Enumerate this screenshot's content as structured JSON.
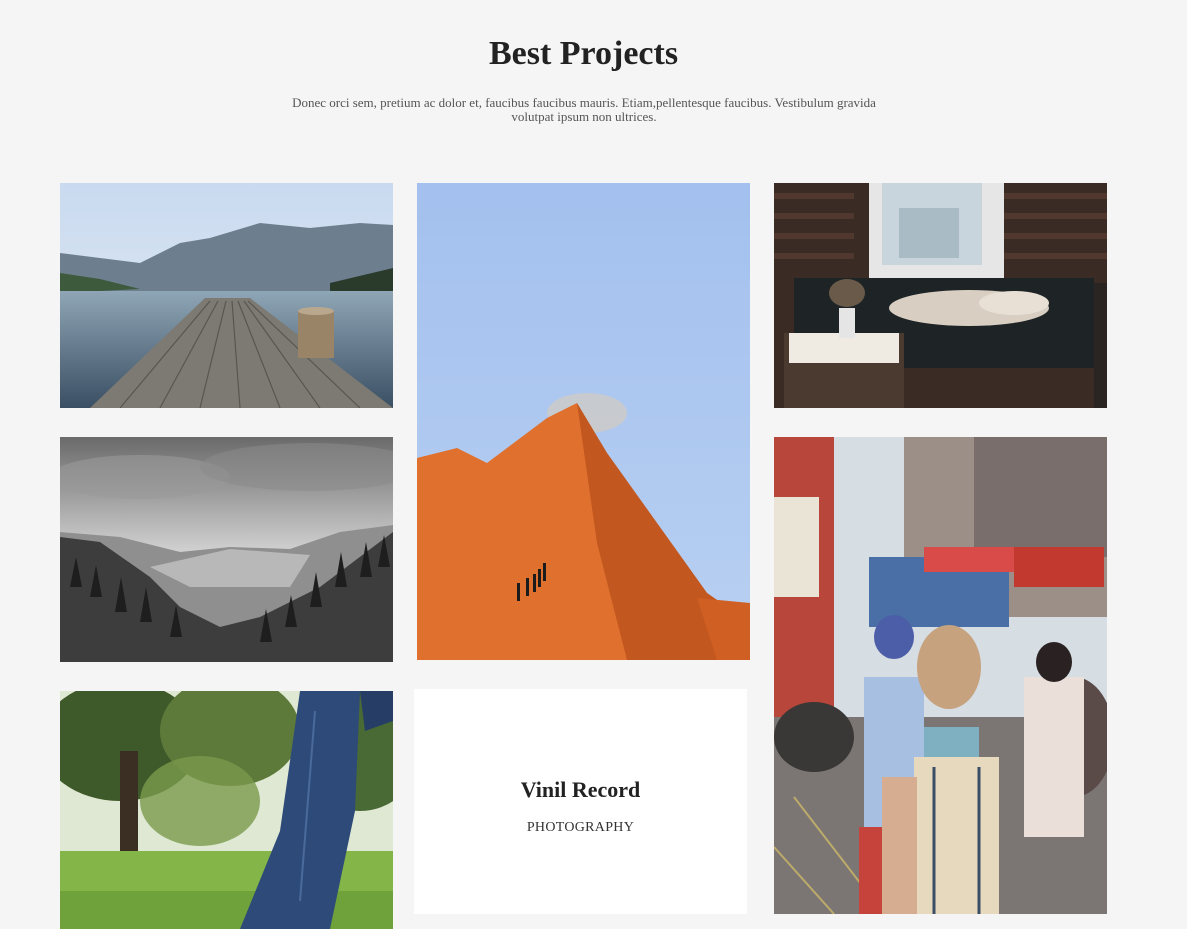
{
  "section": {
    "title": "Best Projects",
    "description": "Donec orci sem, pretium ac dolor et, faucibus faucibus mauris. Etiam,pellentesque faucibus. Vestibulum gravida volutpat ipsum non ultrices."
  },
  "projects": [
    {
      "id": "lake",
      "image": "wooden-pier-over-mountain-lake"
    },
    {
      "id": "forest",
      "image": "black-and-white-forest-hills"
    },
    {
      "id": "grass",
      "image": "person-walking-in-park"
    },
    {
      "id": "dune",
      "image": "people-climbing-orange-sand-dune"
    },
    {
      "id": "room",
      "image": "person-sleeping-on-sofa"
    },
    {
      "id": "street",
      "image": "busy-city-street-market"
    }
  ],
  "featured_card": {
    "title": "Vinil Record",
    "category": "PHOTOGRAPHY"
  },
  "colors": {
    "page_background": "#f5f5f5",
    "card_background": "#ffffff",
    "heading": "#222222",
    "body_text": "#555555"
  }
}
